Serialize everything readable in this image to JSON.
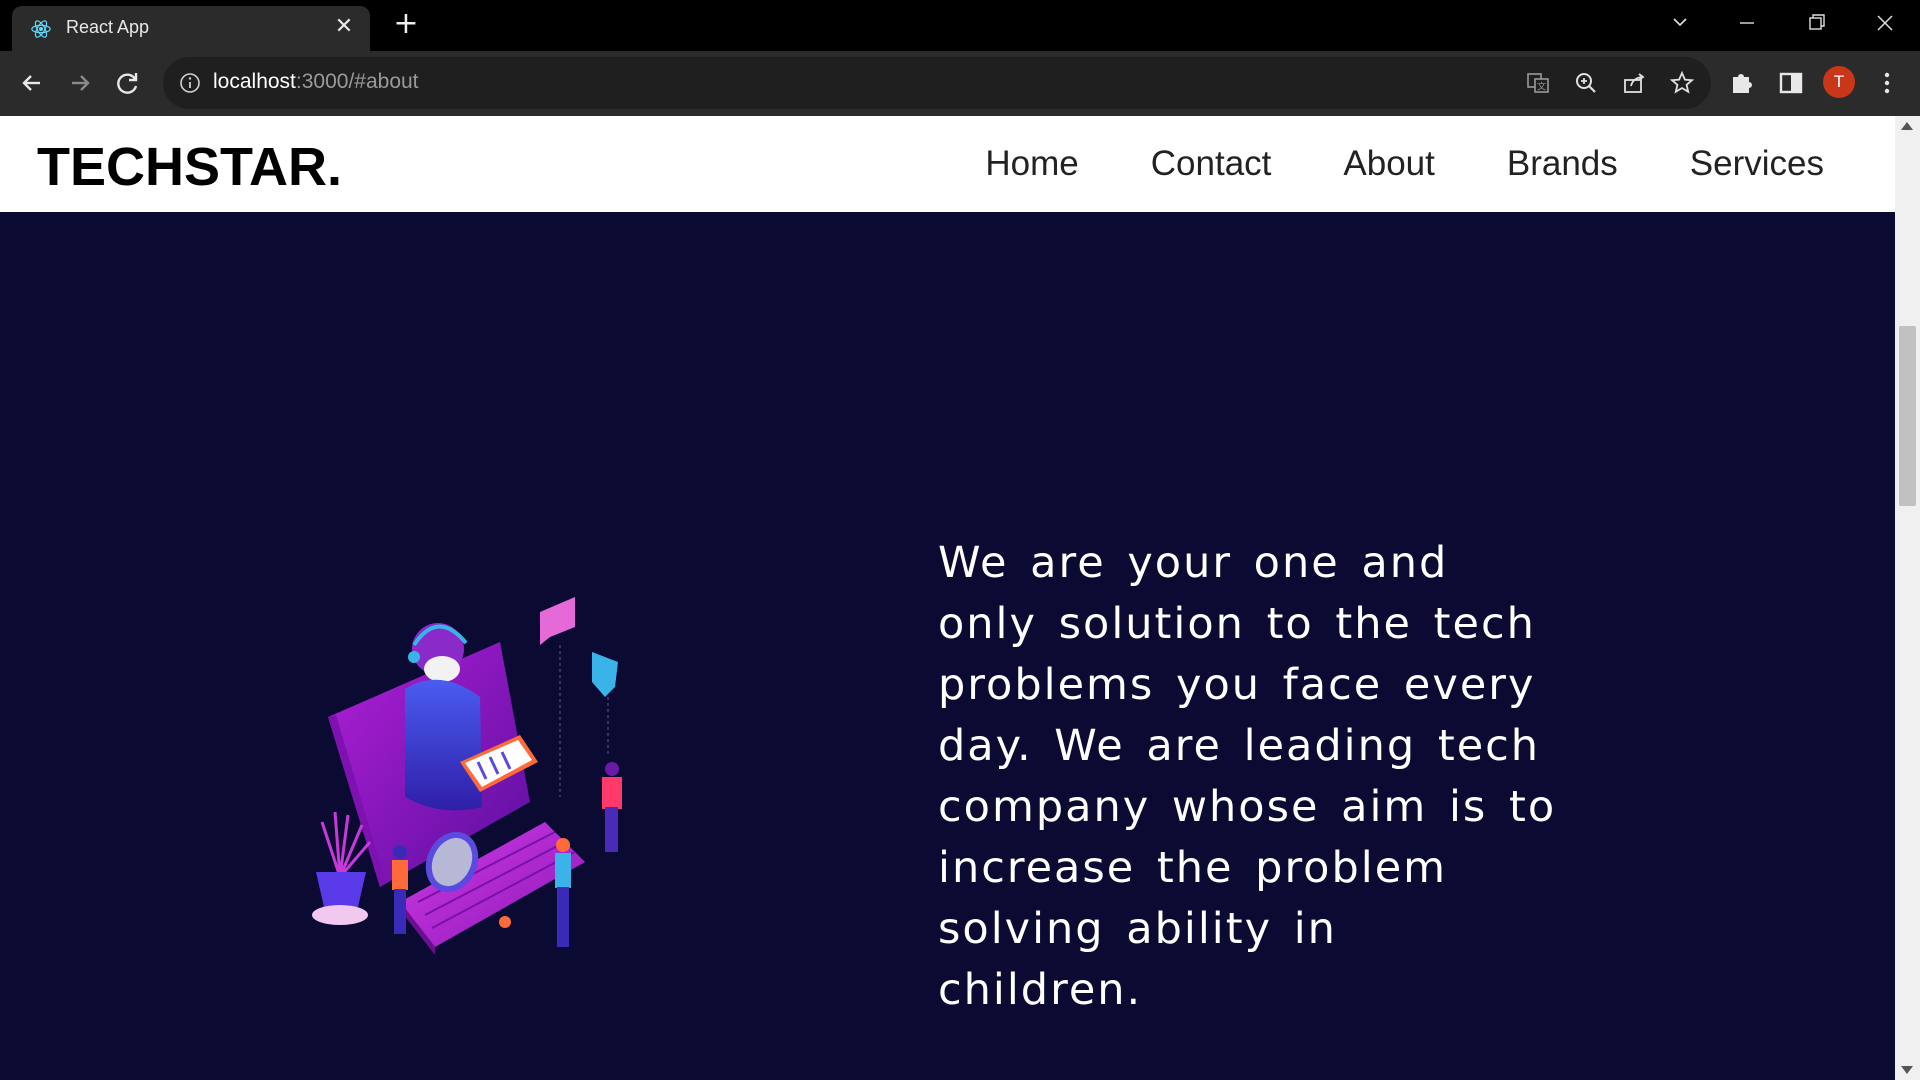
{
  "browser": {
    "tab_title": "React App",
    "tab_close": "✕",
    "new_tab": "+",
    "url_host": "localhost",
    "url_rest": ":3000/#about",
    "avatar_letter": "T"
  },
  "site": {
    "brand": "TECHSTAR.",
    "nav": {
      "home": "Home",
      "contact": "Contact",
      "about": "About",
      "brands": "Brands",
      "services": "Services"
    }
  },
  "about": {
    "text": "We are your one and only solution to the tech problems you face every day. We are leading tech company whose aim is to increase the problem solving ability in children."
  },
  "colors": {
    "page_background": "#0a0a33",
    "navbar_background": "#ffffff",
    "avatar": "#c8371a",
    "chrome_dark": "#2b2b2b"
  },
  "icons": {
    "favicon": "react-icon",
    "back": "arrow-left-icon",
    "forward": "arrow-right-icon",
    "reload": "reload-icon",
    "site_info": "info-icon",
    "translate": "translate-icon",
    "zoom": "zoom-icon",
    "share": "share-icon",
    "bookmark": "star-icon",
    "extensions": "puzzle-icon",
    "side_panel": "side-panel-icon",
    "menu": "kebab-menu-icon"
  }
}
